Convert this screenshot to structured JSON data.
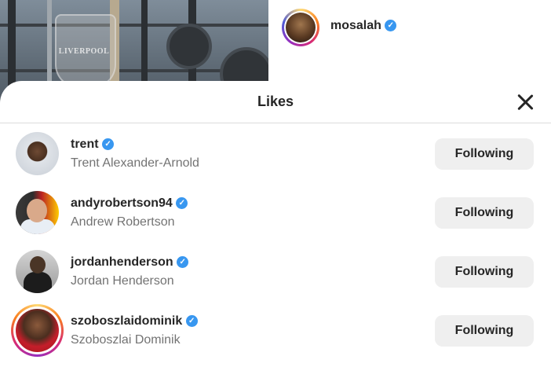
{
  "post": {
    "username": "mosalah",
    "verified_icon": "verified-badge-icon",
    "photo_logo_text": "LIVERPOOL"
  },
  "modal": {
    "title": "Likes",
    "close_icon": "close-icon"
  },
  "likes": [
    {
      "username": "trent",
      "full_name": "Trent Alexander-Arnold",
      "button": "Following",
      "has_story": false
    },
    {
      "username": "andyrobertson94",
      "full_name": "Andrew Robertson",
      "button": "Following",
      "has_story": false
    },
    {
      "username": "jordanhenderson",
      "full_name": "Jordan Henderson",
      "button": "Following",
      "has_story": false
    },
    {
      "username": "szoboszlaidominik",
      "full_name": "Szoboszlai Dominik",
      "button": "Following",
      "has_story": true
    }
  ],
  "colors": {
    "verified": "#3897f0",
    "button_bg": "#efefef",
    "text_primary": "#262626",
    "text_secondary": "#737373"
  }
}
